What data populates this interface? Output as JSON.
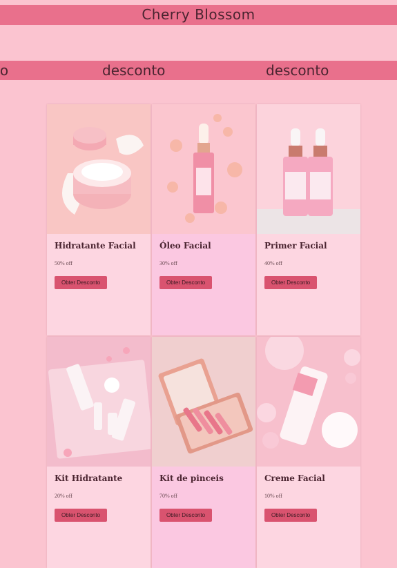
{
  "header": {
    "title": "Cherry Blossom"
  },
  "marquee": {
    "items": [
      "to",
      "desconto",
      "desconto"
    ]
  },
  "products": [
    {
      "name": "Hidratante Facial",
      "discount": "50% off",
      "button": "Obter Desconto",
      "image_icon": "cream-jar-icon"
    },
    {
      "name": "Óleo Facial",
      "discount": "30% off",
      "button": "Obter Desconto",
      "image_icon": "serum-bottle-icon"
    },
    {
      "name": "Primer Facial",
      "discount": "40% off",
      "button": "Obter Desconto",
      "image_icon": "dropper-bottles-icon"
    },
    {
      "name": "Kit Hidratante",
      "discount": "20% off",
      "button": "Obter Desconto",
      "image_icon": "skincare-kit-icon"
    },
    {
      "name": "Kit de pinceis",
      "discount": "70% off",
      "button": "Obter Desconto",
      "image_icon": "makeup-brushes-icon"
    },
    {
      "name": "Creme Facial",
      "discount": "10% off",
      "button": "Obter Desconto",
      "image_icon": "cream-tube-icon"
    }
  ],
  "colors": {
    "page_background": "#fbc4d0",
    "band": "#e9708c",
    "card": "#fdd6e1",
    "card_alt": "#fbc8e1",
    "button": "#d9536f",
    "text": "#4a2430"
  }
}
